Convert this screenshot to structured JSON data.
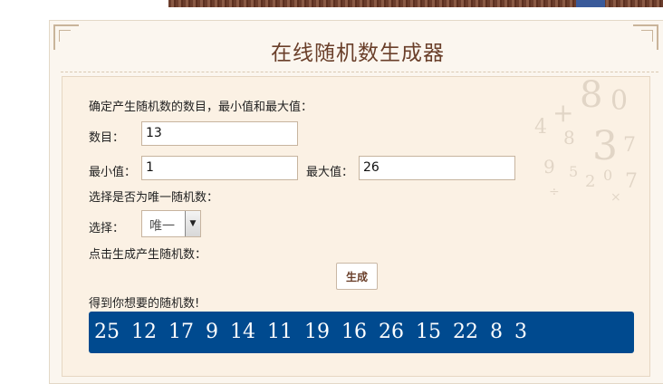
{
  "page": {
    "title": "在线随机数生成器"
  },
  "form": {
    "intro": "确定产生随机数的数目，最小值和最大值：",
    "count_label": "数目：",
    "count_value": "13",
    "min_label": "最小值：",
    "min_value": "1",
    "max_label": "最大值：",
    "max_value": "26",
    "unique_intro": "选择是否为唯一随机数：",
    "select_label": "选择：",
    "select_value": "唯一",
    "generate_intro": "点击生成产生随机数：",
    "generate_button": "生成",
    "result_label": "得到你想要的随机数!",
    "result_numbers": [
      25,
      12,
      17,
      9,
      14,
      11,
      19,
      16,
      26,
      15,
      22,
      8,
      3
    ]
  },
  "colors": {
    "title": "#6a3f2a",
    "result_bg": "#004a8f",
    "panel_bg": "#fbf1e4"
  }
}
